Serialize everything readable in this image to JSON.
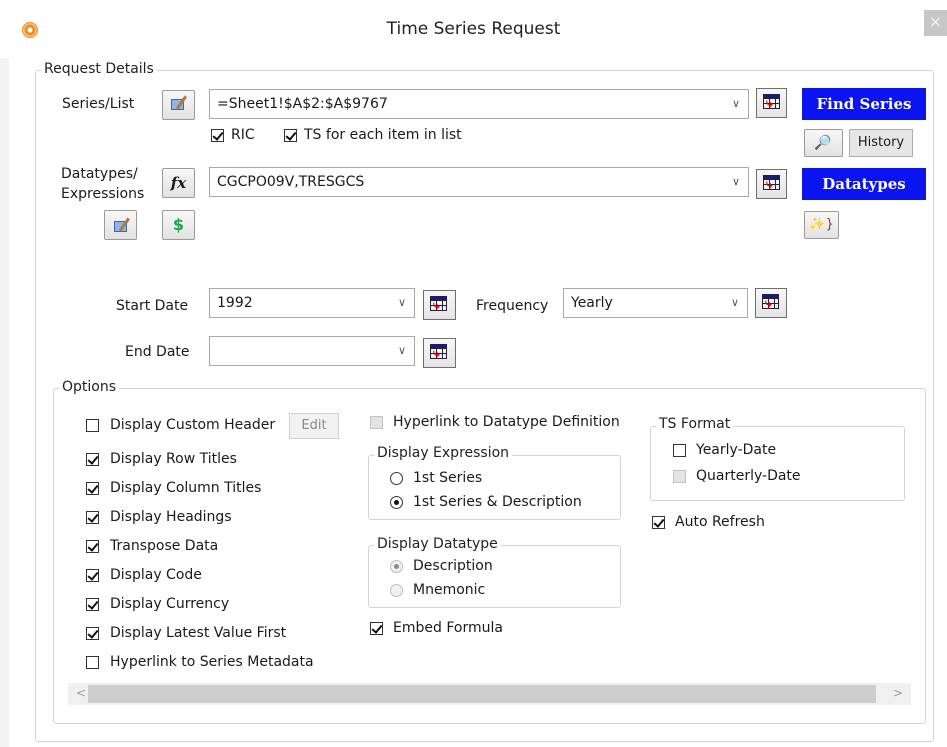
{
  "window": {
    "title": "Time Series Request",
    "close_glyph": "×"
  },
  "request": {
    "legend": "Request Details",
    "series_label": "Series/List",
    "series_value": "=Sheet1!$A$2:$A$9767",
    "find_series": "Find Series",
    "ric_label": "RIC",
    "ric_checked": true,
    "ts_each_label": "TS for each item in list",
    "ts_each_checked": true,
    "history_label": "History",
    "datatypes_label_1": "Datatypes/",
    "datatypes_label_2": "Expressions",
    "fx_glyph": "fx",
    "dollar_glyph": "$",
    "datatypes_value": "CGCPO09V,TRESGCS",
    "datatypes_button": "Datatypes",
    "start_date_label": "Start Date",
    "start_date_value": "1992",
    "end_date_label": "End Date",
    "end_date_value": "",
    "frequency_label": "Frequency",
    "frequency_value": "Yearly"
  },
  "options": {
    "legend": "Options",
    "custom_header": {
      "label": "Display Custom Header",
      "checked": false
    },
    "edit_button": "Edit",
    "left_checks": [
      {
        "label": "Display Row Titles",
        "checked": true
      },
      {
        "label": "Display Column Titles",
        "checked": true
      },
      {
        "label": "Display Headings",
        "checked": true
      },
      {
        "label": "Transpose Data",
        "checked": true
      },
      {
        "label": "Display Code",
        "checked": true
      },
      {
        "label": "Display Currency",
        "checked": true
      },
      {
        "label": "Display Latest Value First",
        "checked": true
      },
      {
        "label": "Hyperlink to Series Metadata",
        "checked": false
      }
    ],
    "hyperlink_datatype": {
      "label": "Hyperlink to Datatype Definition",
      "checked": false,
      "disabled": true
    },
    "display_expression": {
      "legend": "Display Expression",
      "options": [
        "1st Series",
        "1st Series & Description"
      ],
      "selected": 1
    },
    "display_datatype": {
      "legend": "Display Datatype",
      "options": [
        "Description",
        "Mnemonic"
      ],
      "selected": 0,
      "disabled": true
    },
    "embed_formula": {
      "label": "Embed Formula",
      "checked": true
    },
    "ts_format": {
      "legend": "TS Format",
      "yearly": {
        "label": "Yearly-Date",
        "checked": false
      },
      "quarterly": {
        "label": "Quarterly-Date",
        "checked": false,
        "disabled": true
      }
    },
    "auto_refresh": {
      "label": "Auto Refresh",
      "checked": true
    }
  },
  "scroll": {
    "left_glyph": "<",
    "right_glyph": ">"
  },
  "colors": {
    "blue_button": "#0a14f0",
    "app_icon": "#f28a1e"
  }
}
